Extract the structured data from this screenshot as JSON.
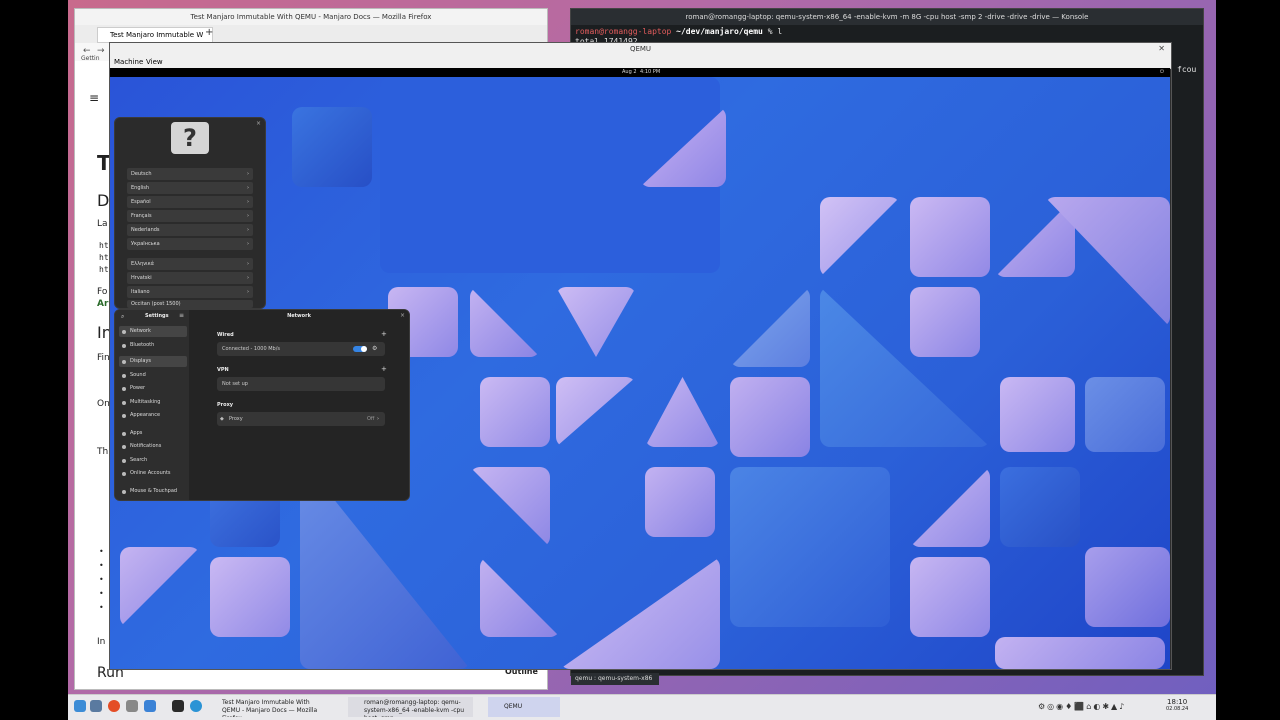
{
  "firefox": {
    "title": "Test Manjaro Immutable With QEMU - Manjaro Docs — Mozilla Firefox",
    "tab_title": "Test Manjaro Immutable W",
    "new_tab": "+",
    "bookmark_fragment": "Gettin",
    "doc_fragments": [
      "T",
      "D",
      "La",
      "ht",
      "ht",
      "ht",
      "Fo",
      "Ar",
      "In",
      "Fin",
      "On",
      "Th",
      "In",
      "Run"
    ],
    "outline_label": "Outline"
  },
  "konsole": {
    "title": "roman@romangg-laptop: qemu-system-x86_64 -enable-kvm -m 8G -cpu host -smp 2 -drive -drive -drive — Konsole",
    "prompt_user": "roman@romangg-laptop",
    "prompt_path": "~/dev/manjaro/qemu",
    "prompt_cmd": "% l",
    "line2": "total 1741492",
    "right_fragment": "fcou",
    "tab_label": "qemu : qemu-system-x86"
  },
  "qemu": {
    "title": "QEMU",
    "menu": [
      "Machine",
      "View"
    ],
    "gnome": {
      "date": "Aug 2",
      "time": "4:10 PM"
    },
    "help_languages": [
      "Deutsch",
      "English",
      "Español",
      "Français",
      "Nederlands",
      "Українська",
      "Ελληνικά",
      "Hrvatski",
      "Italiano",
      "Occitan (post 1500)"
    ],
    "settings": {
      "sidebar_title": "Settings",
      "page_title": "Network",
      "items": [
        "Network",
        "Bluetooth",
        "Displays",
        "Sound",
        "Power",
        "Multitasking",
        "Appearance",
        "Apps",
        "Notifications",
        "Search",
        "Online Accounts",
        "Mouse & Touchpad"
      ],
      "wired_label": "Wired",
      "wired_status": "Connected - 1000 Mb/s",
      "vpn_label": "VPN",
      "vpn_status": "Not set up",
      "proxy_label": "Proxy",
      "proxy_row": "Proxy",
      "proxy_value": "Off"
    }
  },
  "taskbar": {
    "tasks": [
      "Test Manjaro Immutable With QEMU - Manjaro Docs — Mozilla Firefox",
      "roman@romangg-laptop: qemu-system-x86_64 -enable-kvm -cpu host -smp...",
      "QEMU"
    ],
    "time": "18:10",
    "date": "02.08.24"
  }
}
